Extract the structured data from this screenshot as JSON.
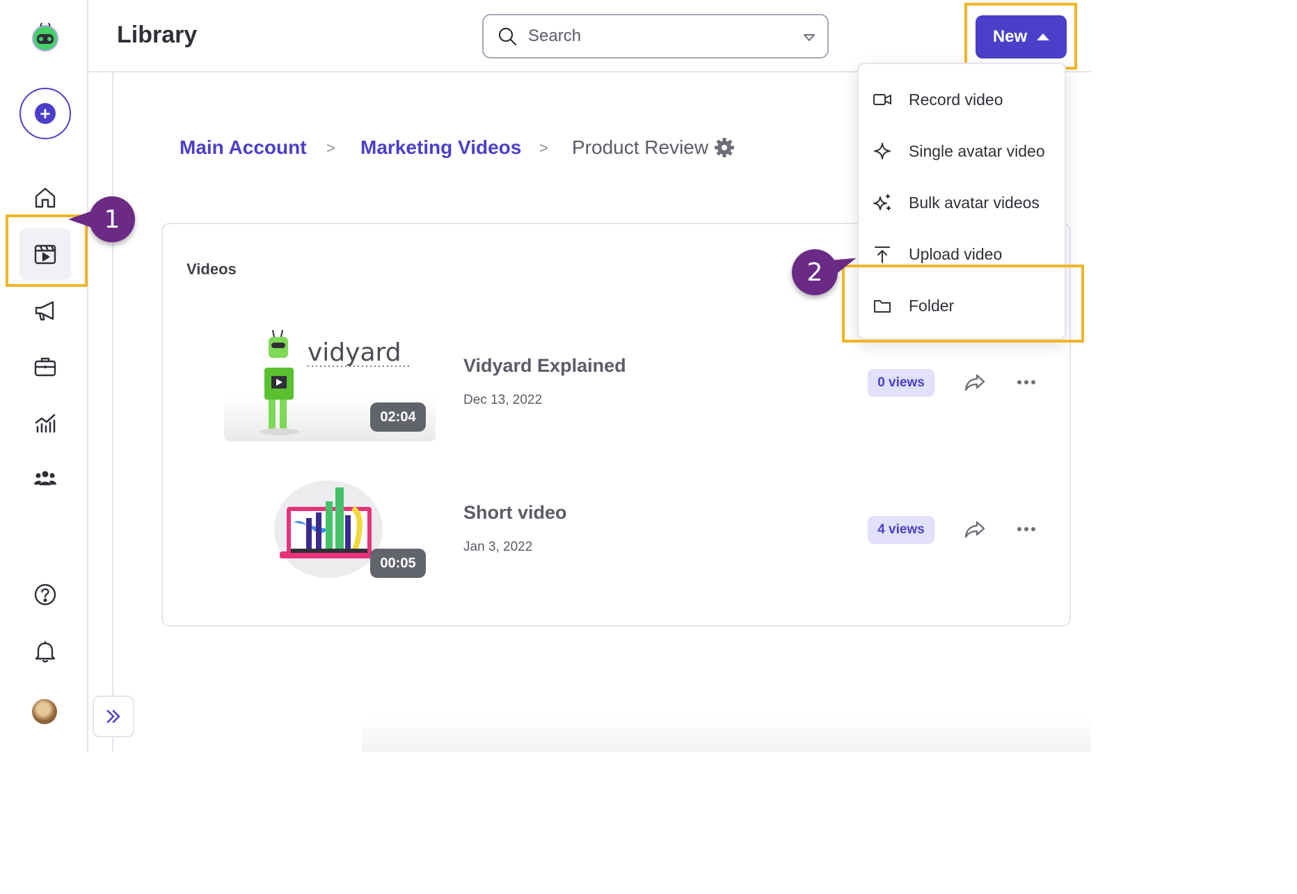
{
  "header": {
    "title": "Library",
    "search_placeholder": "Search",
    "new_button_label": "New"
  },
  "sidebar": {
    "items": [
      {
        "name": "home-icon"
      },
      {
        "name": "library-icon",
        "active": true
      },
      {
        "name": "megaphone-icon"
      },
      {
        "name": "briefcase-icon"
      },
      {
        "name": "analytics-icon"
      },
      {
        "name": "team-icon"
      },
      {
        "name": "help-icon"
      },
      {
        "name": "bell-icon"
      }
    ]
  },
  "breadcrumb": {
    "items": [
      "Main Account",
      "Marketing Videos",
      "Product Review"
    ],
    "separator": ">"
  },
  "videos_section": {
    "title": "Videos",
    "videos": [
      {
        "title": "Vidyard Explained",
        "date": "Dec 13, 2022",
        "duration": "02:04",
        "views": "0 views",
        "thumb_text": "vidyard"
      },
      {
        "title": "Short video",
        "date": "Jan 3, 2022",
        "duration": "00:05",
        "views": "4 views"
      }
    ]
  },
  "new_menu": {
    "items": [
      {
        "label": "Record video",
        "icon": "video-camera-icon"
      },
      {
        "label": "Single avatar video",
        "icon": "sparkle-icon"
      },
      {
        "label": "Bulk avatar videos",
        "icon": "sparkles-icon"
      },
      {
        "label": "Upload video",
        "icon": "upload-icon"
      },
      {
        "label": "Folder",
        "icon": "folder-icon"
      }
    ]
  },
  "callouts": [
    "1",
    "2"
  ],
  "colors": {
    "accent": "#4b3fc9",
    "highlight": "#f2b523",
    "callout": "#6b2a86",
    "views_badge_bg": "#e2e0fa"
  }
}
